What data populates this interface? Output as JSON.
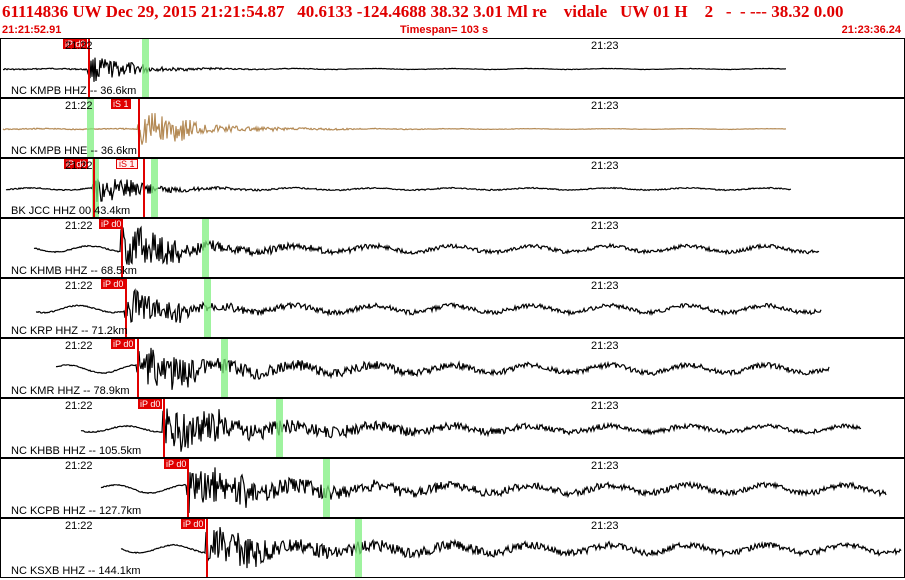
{
  "header": {
    "title": "61114836 UW Dec 29, 2015 21:21:54.87   40.6133 -124.4688 38.32 3.01 Ml re    vidale   UW 01 H    2   -  - --- 38.32 0.00",
    "start_time": "21:21:52.91",
    "timespan": "Timespan= 103 s",
    "end_time": "21:23:36.24"
  },
  "colors": {
    "header_text": "#e00000",
    "pick": "#e00000",
    "s_window": "#7fef7f",
    "trace": "#000000",
    "hne_trace": "#b48a55"
  },
  "panels": [
    {
      "channel": "NC KMPB HHZ -- 36.6km",
      "time1": "21:22",
      "time2": "21:23",
      "picks": [
        {
          "label": "iP d0",
          "style": "solid"
        }
      ],
      "trace_color": "#000000"
    },
    {
      "channel": "NC KMPB HNE -- 36.6km",
      "time1": "21:22",
      "time2": "21:23",
      "picks": [
        {
          "label": "iS 1",
          "style": "solid"
        }
      ],
      "trace_color": "#b48a55"
    },
    {
      "channel": "BK JCC HHZ 00 43.4km",
      "time1": "21:22",
      "time2": "21:23",
      "picks": [
        {
          "label": "iP d0",
          "style": "solid"
        },
        {
          "label": "iS 1",
          "style": "outline"
        }
      ],
      "trace_color": "#000000"
    },
    {
      "channel": "NC KHMB HHZ -- 68.5km",
      "time1": "21:22",
      "time2": "21:23",
      "picks": [
        {
          "label": "iP d0",
          "style": "solid"
        }
      ],
      "trace_color": "#000000"
    },
    {
      "channel": "NC KRP HHZ -- 71.2km",
      "time1": "21:22",
      "time2": "21:23",
      "picks": [
        {
          "label": "iP d0",
          "style": "solid"
        }
      ],
      "trace_color": "#000000"
    },
    {
      "channel": "NC KMR HHZ -- 78.9km",
      "time1": "21:22",
      "time2": "21:23",
      "picks": [
        {
          "label": "iP d0",
          "style": "solid"
        }
      ],
      "trace_color": "#000000"
    },
    {
      "channel": "NC KHBB HHZ -- 105.5km",
      "time1": "21:22",
      "time2": "21:23",
      "picks": [
        {
          "label": "iP d0",
          "style": "solid"
        }
      ],
      "trace_color": "#000000"
    },
    {
      "channel": "NC KCPB HHZ -- 127.7km",
      "time1": "21:22",
      "time2": "21:23",
      "picks": [
        {
          "label": "iP d0",
          "style": "solid"
        }
      ],
      "trace_color": "#000000"
    },
    {
      "channel": "NC KSXB HHZ -- 144.1km",
      "time1": "21:22",
      "time2": "21:23",
      "picks": [
        {
          "label": "iP d0",
          "style": "solid"
        }
      ],
      "trace_color": "#000000"
    }
  ]
}
